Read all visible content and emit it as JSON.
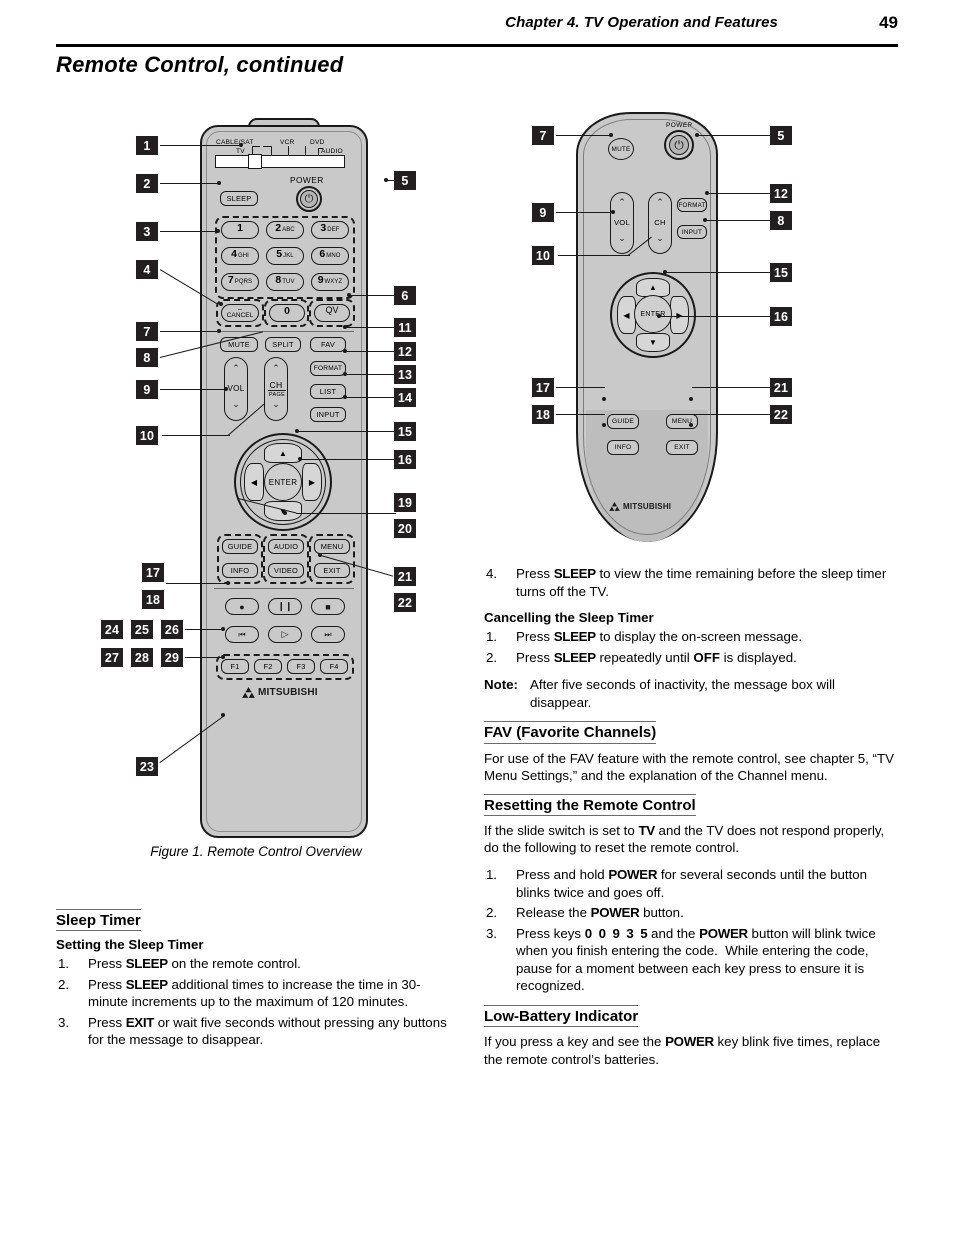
{
  "header": {
    "chapter": "Chapter 4. TV Operation and Features",
    "page_number": "49"
  },
  "page_title": "Remote Control, continued",
  "figure": {
    "caption": "Figure 1.  Remote Control Overview",
    "main_remote": {
      "slide_switch_labels": [
        "CABLE/SAT",
        "TV",
        "VCR",
        "DVD",
        "AUDIO"
      ],
      "power_label": "POWER",
      "buttons": {
        "sleep": "SLEEP",
        "cancel_dash": "–",
        "cancel": "CANCEL",
        "zero": "0",
        "qv": "QV",
        "mute": "MUTE",
        "split": "SPLIT",
        "fav": "FAV",
        "format": "FORMAT",
        "list": "LIST",
        "input": "INPUT",
        "vol": "VOL",
        "ch": "CH",
        "page": "PAGE",
        "enter": "ENTER",
        "guide": "GUIDE",
        "audio": "AUDIO",
        "menu": "MENU",
        "info": "INFO",
        "video": "VIDEO",
        "exit": "EXIT"
      },
      "numeric_keys": [
        {
          "digit": "1",
          "letters": ""
        },
        {
          "digit": "2",
          "letters": "ABC"
        },
        {
          "digit": "3",
          "letters": "DEF"
        },
        {
          "digit": "4",
          "letters": "GHI"
        },
        {
          "digit": "5",
          "letters": "JKL"
        },
        {
          "digit": "6",
          "letters": "MNO"
        },
        {
          "digit": "7",
          "letters": "PQRS"
        },
        {
          "digit": "8",
          "letters": "TUV"
        },
        {
          "digit": "9",
          "letters": "WXYZ"
        }
      ],
      "function_keys": [
        "F1",
        "F2",
        "F3",
        "F4"
      ],
      "transport_icons": [
        "record-icon",
        "pause-icon",
        "stop-icon",
        "skip-back-icon",
        "play-icon",
        "skip-forward-icon"
      ],
      "brand": "MITSUBISHI",
      "callouts": [
        "1",
        "2",
        "3",
        "4",
        "5",
        "6",
        "7",
        "8",
        "9",
        "10",
        "11",
        "12",
        "13",
        "14",
        "15",
        "16",
        "17",
        "18",
        "19",
        "20",
        "21",
        "22",
        "23",
        "24",
        "25",
        "26",
        "27",
        "28",
        "29"
      ]
    },
    "second_remote": {
      "power_label": "POWER",
      "buttons": {
        "mute": "MUTE",
        "vol": "VOL",
        "ch": "CH",
        "format": "FORMAT",
        "input": "INPUT",
        "enter": "ENTER",
        "guide": "GUIDE",
        "menu": "MENU",
        "info": "INFO",
        "exit": "EXIT"
      },
      "brand": "MITSUBISHI",
      "callouts": [
        "5",
        "7",
        "8",
        "9",
        "10",
        "12",
        "15",
        "16",
        "17",
        "18",
        "21",
        "22"
      ]
    }
  },
  "left_column": {
    "sleep_timer": {
      "heading": "Sleep Timer",
      "subheading": "Setting the Sleep Timer",
      "steps": [
        "Press SLEEP on the remote control.",
        "Press SLEEP additional times to increase the time in 30-minute increments up to the maximum of 120 minutes.",
        "Press EXIT or wait five seconds without pressing any buttons for the message to disappear."
      ]
    }
  },
  "right_column": {
    "sleep_continued": {
      "step4": "Press SLEEP to view the time remaining before the sleep timer turns off the TV."
    },
    "cancelling": {
      "subheading": "Cancelling the Sleep Timer",
      "steps": [
        "Press SLEEP to display the on-screen message.",
        "Press SLEEP repeatedly until OFF is displayed."
      ],
      "note_label": "Note:",
      "note_text": "After five seconds of inactivity, the message box will disappear."
    },
    "fav": {
      "heading": "FAV (Favorite Channels)",
      "body": "For use of the FAV feature with the remote control, see chapter 5, “TV Menu Settings,” and the explanation of the Channel menu."
    },
    "resetting": {
      "heading": "Resetting the Remote Control",
      "intro": "If the slide switch is set to TV and the TV does not respond properly, do the following to reset the remote control.",
      "steps": [
        "Press and hold POWER for several seconds until the button blinks twice and goes off.",
        "Release the POWER button.",
        "Press keys 0 0 9 3 5 and the POWER button will blink twice when you finish entering the code.  While entering the code, pause for a moment between each key press to ensure it is recognized."
      ]
    },
    "low_battery": {
      "heading": "Low-Battery Indicator",
      "body": "If you press a key and see the POWER key blink five times, replace the remote control’s batteries."
    }
  },
  "colors": {
    "callout_bg": "#231f20",
    "remote_body": "#c9c9c9",
    "outline": "#1a1a1a"
  }
}
